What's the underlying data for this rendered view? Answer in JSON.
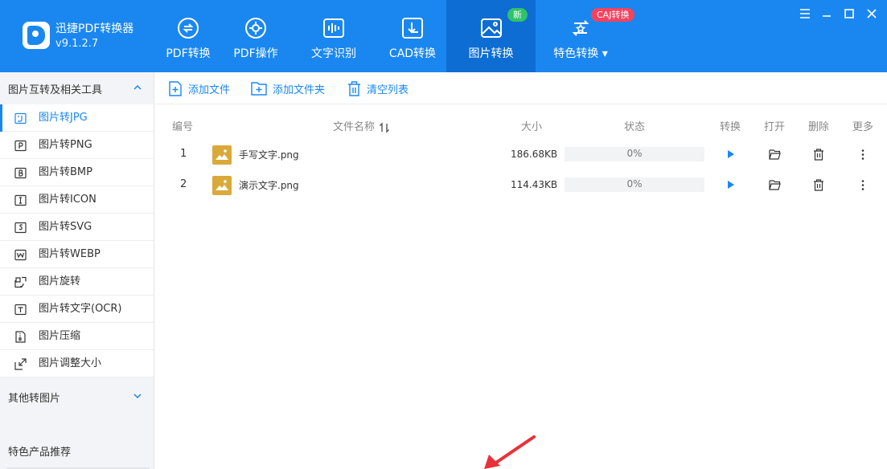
{
  "app": {
    "title": "迅捷PDF转换器",
    "version": "v9.1.2.7"
  },
  "nav": {
    "tabs": [
      {
        "label": "PDF转换",
        "icon": "pdf-convert-icon"
      },
      {
        "label": "PDF操作",
        "icon": "pdf-operate-icon"
      },
      {
        "label": "文字识别",
        "icon": "text-recognition-icon"
      },
      {
        "label": "CAD转换",
        "icon": "cad-convert-icon"
      },
      {
        "label": "图片转换",
        "icon": "image-convert-icon"
      },
      {
        "label": "特色转换 ▾",
        "icon": "special-convert-icon"
      }
    ],
    "badges": {
      "new": "新",
      "caj": "CAJ转换"
    }
  },
  "sidebar": {
    "section1": "图片互转及相关工具",
    "items": [
      {
        "label": "图片转JPG",
        "icon": "image-jpg-icon"
      },
      {
        "label": "图片转PNG",
        "icon": "image-png-icon"
      },
      {
        "label": "图片转BMP",
        "icon": "image-bmp-icon"
      },
      {
        "label": "图片转ICON",
        "icon": "image-icon-icon"
      },
      {
        "label": "图片转SVG",
        "icon": "image-svg-icon"
      },
      {
        "label": "图片转WEBP",
        "icon": "image-webp-icon"
      },
      {
        "label": "图片旋转",
        "icon": "image-rotate-icon"
      },
      {
        "label": "图片转文字(OCR)",
        "icon": "image-ocr-icon"
      },
      {
        "label": "图片压缩",
        "icon": "image-compress-icon"
      },
      {
        "label": "图片调整大小",
        "icon": "image-resize-icon"
      }
    ],
    "section2": "其他转图片",
    "footer": "特色产品推荐"
  },
  "toolbar": {
    "add_file": "添加文件",
    "add_folder": "添加文件夹",
    "clear_list": "清空列表"
  },
  "table": {
    "headers": {
      "index": "编号",
      "name": "文件名称",
      "size": "大小",
      "status": "状态",
      "convert": "转换",
      "open": "打开",
      "delete": "删除",
      "more": "更多"
    },
    "rows": [
      {
        "index": "1",
        "name": "手写文字.png",
        "size": "186.68KB",
        "progress": "0%"
      },
      {
        "index": "2",
        "name": "演示文字.png",
        "size": "114.43KB",
        "progress": "0%"
      }
    ]
  },
  "colors": {
    "primary": "#1a87f0",
    "active_tab": "#0d6dd3",
    "badge_new": "#31c26a",
    "badge_caj": "#f3435f",
    "arrow": "#e8323a"
  }
}
